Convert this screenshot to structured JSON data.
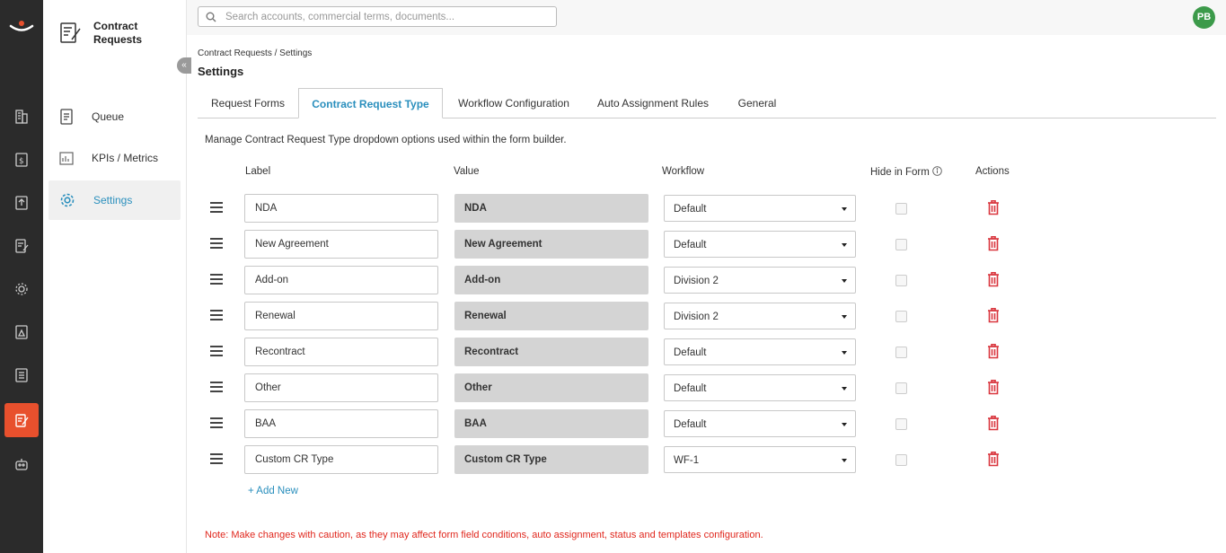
{
  "app": {
    "module_title": "Contract Requests",
    "brand_color": "#e8502d",
    "accent_color": "#2a8fbd"
  },
  "rail": {
    "icons": [
      "buildings-icon",
      "dollar-doc-icon",
      "upload-doc-icon",
      "edit-doc-icon",
      "gear-cluster-icon",
      "triangle-doc-icon",
      "list-doc-icon",
      "contract-requests-icon",
      "robot-icon"
    ],
    "active_index": 7
  },
  "sidebar": {
    "items": [
      {
        "label": "Queue",
        "icon": "document-icon"
      },
      {
        "label": "KPIs / Metrics",
        "icon": "chart-icon"
      },
      {
        "label": "Settings",
        "icon": "gear-icon",
        "active": true
      }
    ]
  },
  "search": {
    "placeholder": "Search accounts, commercial terms, documents..."
  },
  "user": {
    "initials": "PB"
  },
  "breadcrumb": "Contract Requests / Settings",
  "page_title": "Settings",
  "tabs": [
    {
      "label": "Request Forms"
    },
    {
      "label": "Contract Request Type",
      "active": true
    },
    {
      "label": "Workflow Configuration"
    },
    {
      "label": "Auto Assignment Rules"
    },
    {
      "label": "General"
    }
  ],
  "description": "Manage Contract Request Type dropdown options used within the form builder.",
  "table": {
    "headers": {
      "label": "Label",
      "value": "Value",
      "workflow": "Workflow",
      "hide": "Hide in Form",
      "actions": "Actions"
    },
    "rows": [
      {
        "label": "NDA",
        "value": "NDA",
        "workflow": "Default",
        "hidden": false
      },
      {
        "label": "New Agreement",
        "value": "New Agreement",
        "workflow": "Default",
        "hidden": false
      },
      {
        "label": "Add-on",
        "value": "Add-on",
        "workflow": "Division 2",
        "hidden": false
      },
      {
        "label": "Renewal",
        "value": "Renewal",
        "workflow": "Division 2",
        "hidden": false
      },
      {
        "label": "Recontract",
        "value": "Recontract",
        "workflow": "Default",
        "hidden": false
      },
      {
        "label": "Other",
        "value": "Other",
        "workflow": "Default",
        "hidden": false
      },
      {
        "label": "BAA",
        "value": "BAA",
        "workflow": "Default",
        "hidden": false
      },
      {
        "label": "Custom CR Type",
        "value": "Custom CR Type",
        "workflow": "WF-1",
        "hidden": false
      }
    ]
  },
  "add_new_label": "+ Add New",
  "note": "Note: Make changes with caution, as they may affect form field conditions, auto assignment, status and templates configuration."
}
